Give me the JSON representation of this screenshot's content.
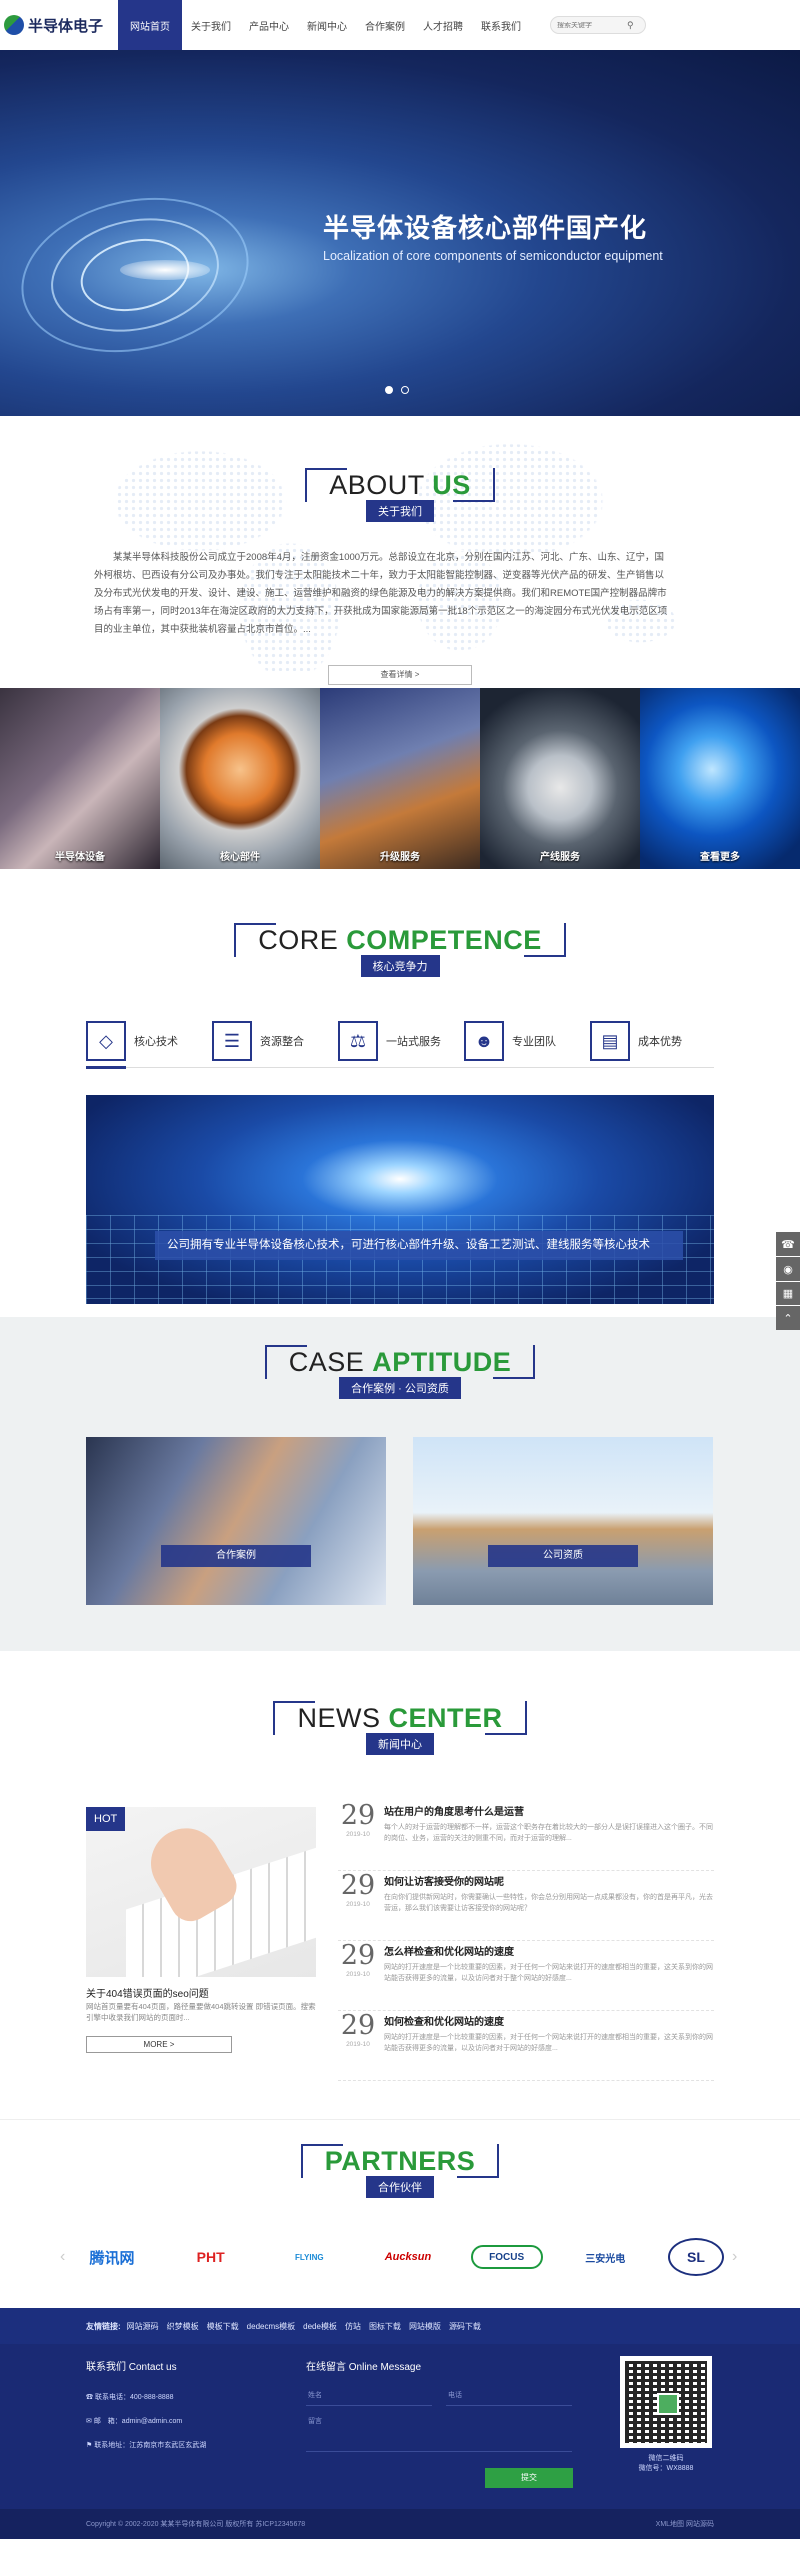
{
  "header": {
    "logo_text": "半导体电子",
    "nav": [
      "网站首页",
      "关于我们",
      "产品中心",
      "新闻中心",
      "合作案例",
      "人才招聘",
      "联系我们"
    ],
    "search_placeholder": "搜索关键字"
  },
  "banner": {
    "title": "半导体设备核心部件国产化",
    "subtitle": "Localization of core components of semiconductor equipment"
  },
  "about": {
    "en_a": "ABOUT ",
    "en_b": "US",
    "cn": "关于我们",
    "text": "某某半导体科技股份公司成立于2008年4月，注册资金1000万元。总部设立在北京，分别在国内江苏、河北、广东、山东、辽宁，国外柯根坊、巴西设有分公司及办事处。我们专注于太阳能技术二十年，致力于太阳能智能控制器、逆变器等光伏产品的研发、生产销售以及分布式光伏发电的开发、设计、建设、施工、运营维护和融资的绿色能源及电力的解决方案提供商。我们和REMOTE国产控制器品牌市场占有率第一，同时2013年在海淀区政府的大力支持下，开获批成为国家能源局第一批18个示范区之一的海淀园分布式光伏发电示范区项目的业主单位，其中获批装机容量占北京市首位。...",
    "more": "查看详情 >"
  },
  "strip": [
    "半导体设备",
    "核心部件",
    "升级服务",
    "产线服务",
    "查看更多"
  ],
  "competence": {
    "en_a": "CORE ",
    "en_b": "COMPETENCE",
    "cn": "核心竞争力",
    "features": [
      "核心技术",
      "资源整合",
      "一站式服务",
      "专业团队",
      "成本优势"
    ],
    "caption": "公司拥有专业半导体设备核心技术，可进行核心部件升级、设备工艺测试、建线服务等核心技术"
  },
  "case": {
    "en_a": "CASE ",
    "en_b": "APTITUDE",
    "cn": "合作案例 · 公司资质",
    "cards": [
      "合作案例",
      "公司资质"
    ]
  },
  "news": {
    "en_a": "NEWS ",
    "en_b": "CENTER",
    "cn": "新闻中心",
    "hot_badge": "HOT",
    "hot_title": "关于404错误页面的seo问题",
    "hot_desc": "网站首页量要有404页面，路径量要做404跳转设置 即错误页面。搜索引擎中收录我们网站的页面时...",
    "hot_more": "MORE >",
    "items": [
      {
        "day": "29",
        "ym": "2019-10",
        "title": "站在用户的角度思考什么是运营",
        "desc": "每个人的对于运营的理解都不一样，运营这个职务存在着比较大的一部分人是误打误撞进入这个圈子。不同的岗位、业务，运营的关注的侧重不同，而对于运营的理解..."
      },
      {
        "day": "29",
        "ym": "2019-10",
        "title": "如何让访客接受你的网站呢",
        "desc": "在向你们提供新网站时，你需要确认一些特性，你会总分别用网站一点成果都没有，你的首是再平凡，光去营运，那么我们该需要让访客接受你的网站呢？"
      },
      {
        "day": "29",
        "ym": "2019-10",
        "title": "怎么样检查和优化网站的速度",
        "desc": "网站的打开速度是一个比较重要的因素，对于任何一个网站来说打开的速度都相当的重要，这关系到你的网站能否获得更多的流量，以及访问者对于整个网站的好感度..."
      },
      {
        "day": "29",
        "ym": "2019-10",
        "title": "如何检查和优化网站的速度",
        "desc": "网站的打开速度是一个比较重要的因素，对于任何一个网站来说打开的速度都相当的重要，这关系到你的网站能否获得更多的流量，以及访问者对于网站的好感度..."
      }
    ]
  },
  "partners": {
    "en": "PARTNERS",
    "cn": "合作伙伴",
    "logos": [
      "腾讯网",
      "PHT",
      "FLYING",
      "Aucksun",
      "FOCUS",
      "三安光电",
      "SL"
    ]
  },
  "footer": {
    "links_title": "友情链接:",
    "links": [
      "网站源码",
      "织梦模板",
      "模板下载",
      "dedecms模板",
      "dede模板",
      "仿站",
      "图标下载",
      "网站模版",
      "源码下载"
    ],
    "contact_title": "联系我们 Contact us",
    "phone": "联系电话：400-888-8888",
    "email": "邮　箱：admin@admin.com",
    "address": "联系地址：江苏南京市玄武区玄武湖",
    "message_title": "在线留言 Online Message",
    "name_ph": "姓名",
    "phone_ph": "电话",
    "content_ph": "留言",
    "submit": "提交",
    "qr_cap1": "微信二维码",
    "qr_cap2": "微信号：WX8888",
    "copyright": "Copyright © 2002-2020 某某半导体有限公司 版权所有   苏ICP12345678",
    "right_links": "XML地图  网站源码"
  }
}
